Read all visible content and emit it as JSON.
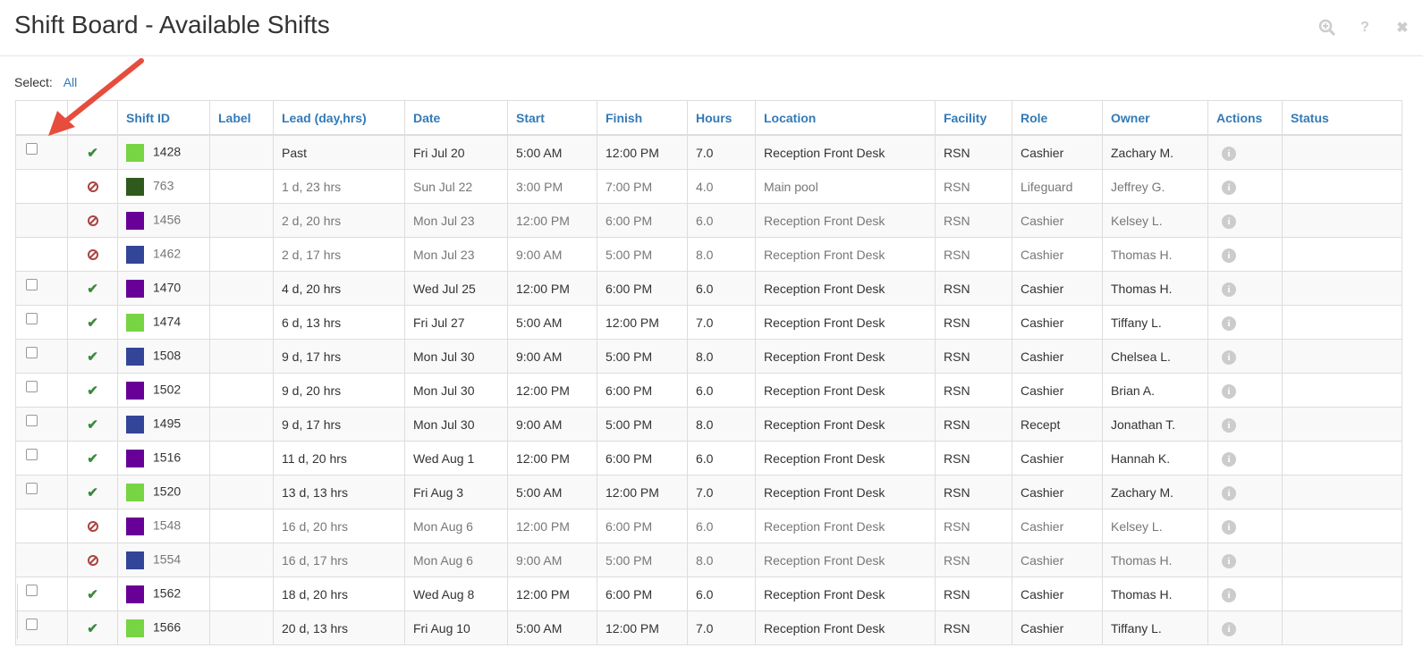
{
  "header": {
    "title": "Shift Board - Available Shifts",
    "icons": [
      "zoom-in-icon",
      "help-icon",
      "close-icon"
    ],
    "help_glyph": "?",
    "close_glyph": "✖"
  },
  "select": {
    "label": "Select:",
    "all_link": "All"
  },
  "columns": [
    "",
    "",
    "Shift ID",
    "Label",
    "Lead (day,hrs)",
    "Date",
    "Start",
    "Finish",
    "Hours",
    "Location",
    "Facility",
    "Role",
    "Owner",
    "Actions",
    "Status"
  ],
  "colors": {
    "green": "#77d442",
    "darkgreen": "#2f5a1e",
    "purple": "#680097",
    "blue": "#334599",
    "ok": "#3c8a3c",
    "blocked": "#a94442",
    "link": "#337ab7"
  },
  "rows": [
    {
      "selectable": true,
      "status": "ok",
      "color": "green",
      "id": "1428",
      "label": "",
      "lead": "Past",
      "date": "Fri Jul 20",
      "start": "5:00 AM",
      "finish": "12:00 PM",
      "hours": "7.0",
      "location": "Reception Front Desk",
      "facility": "RSN",
      "role": "Cashier",
      "owner": "Zachary M.",
      "status_text": ""
    },
    {
      "selectable": false,
      "status": "blocked",
      "color": "darkgreen",
      "id": "763",
      "label": "",
      "lead": "1 d, 23 hrs",
      "date": "Sun Jul 22",
      "start": "3:00 PM",
      "finish": "7:00 PM",
      "hours": "4.0",
      "location": "Main pool",
      "facility": "RSN",
      "role": "Lifeguard",
      "owner": "Jeffrey G.",
      "status_text": ""
    },
    {
      "selectable": false,
      "status": "blocked",
      "color": "purple",
      "id": "1456",
      "label": "",
      "lead": "2 d, 20 hrs",
      "date": "Mon Jul 23",
      "start": "12:00 PM",
      "finish": "6:00 PM",
      "hours": "6.0",
      "location": "Reception Front Desk",
      "facility": "RSN",
      "role": "Cashier",
      "owner": "Kelsey L.",
      "status_text": ""
    },
    {
      "selectable": false,
      "status": "blocked",
      "color": "blue",
      "id": "1462",
      "label": "",
      "lead": "2 d, 17 hrs",
      "date": "Mon Jul 23",
      "start": "9:00 AM",
      "finish": "5:00 PM",
      "hours": "8.0",
      "location": "Reception Front Desk",
      "facility": "RSN",
      "role": "Cashier",
      "owner": "Thomas H.",
      "status_text": ""
    },
    {
      "selectable": true,
      "status": "ok",
      "color": "purple",
      "id": "1470",
      "label": "",
      "lead": "4 d, 20 hrs",
      "date": "Wed Jul 25",
      "start": "12:00 PM",
      "finish": "6:00 PM",
      "hours": "6.0",
      "location": "Reception Front Desk",
      "facility": "RSN",
      "role": "Cashier",
      "owner": "Thomas H.",
      "status_text": ""
    },
    {
      "selectable": true,
      "status": "ok",
      "color": "green",
      "id": "1474",
      "label": "",
      "lead": "6 d, 13 hrs",
      "date": "Fri Jul 27",
      "start": "5:00 AM",
      "finish": "12:00 PM",
      "hours": "7.0",
      "location": "Reception Front Desk",
      "facility": "RSN",
      "role": "Cashier",
      "owner": "Tiffany L.",
      "status_text": ""
    },
    {
      "selectable": true,
      "status": "ok",
      "color": "blue",
      "id": "1508",
      "label": "",
      "lead": "9 d, 17 hrs",
      "date": "Mon Jul 30",
      "start": "9:00 AM",
      "finish": "5:00 PM",
      "hours": "8.0",
      "location": "Reception Front Desk",
      "facility": "RSN",
      "role": "Cashier",
      "owner": "Chelsea L.",
      "status_text": ""
    },
    {
      "selectable": true,
      "status": "ok",
      "color": "purple",
      "id": "1502",
      "label": "",
      "lead": "9 d, 20 hrs",
      "date": "Mon Jul 30",
      "start": "12:00 PM",
      "finish": "6:00 PM",
      "hours": "6.0",
      "location": "Reception Front Desk",
      "facility": "RSN",
      "role": "Cashier",
      "owner": "Brian A.",
      "status_text": ""
    },
    {
      "selectable": true,
      "status": "ok",
      "color": "blue",
      "id": "1495",
      "label": "",
      "lead": "9 d, 17 hrs",
      "date": "Mon Jul 30",
      "start": "9:00 AM",
      "finish": "5:00 PM",
      "hours": "8.0",
      "location": "Reception Front Desk",
      "facility": "RSN",
      "role": "Recept",
      "owner": "Jonathan T.",
      "status_text": ""
    },
    {
      "selectable": true,
      "status": "ok",
      "color": "purple",
      "id": "1516",
      "label": "",
      "lead": "11 d, 20 hrs",
      "date": "Wed Aug 1",
      "start": "12:00 PM",
      "finish": "6:00 PM",
      "hours": "6.0",
      "location": "Reception Front Desk",
      "facility": "RSN",
      "role": "Cashier",
      "owner": "Hannah K.",
      "status_text": ""
    },
    {
      "selectable": true,
      "status": "ok",
      "color": "green",
      "id": "1520",
      "label": "",
      "lead": "13 d, 13 hrs",
      "date": "Fri Aug 3",
      "start": "5:00 AM",
      "finish": "12:00 PM",
      "hours": "7.0",
      "location": "Reception Front Desk",
      "facility": "RSN",
      "role": "Cashier",
      "owner": "Zachary M.",
      "status_text": ""
    },
    {
      "selectable": false,
      "status": "blocked",
      "color": "purple",
      "id": "1548",
      "label": "",
      "lead": "16 d, 20 hrs",
      "date": "Mon Aug 6",
      "start": "12:00 PM",
      "finish": "6:00 PM",
      "hours": "6.0",
      "location": "Reception Front Desk",
      "facility": "RSN",
      "role": "Cashier",
      "owner": "Kelsey L.",
      "status_text": ""
    },
    {
      "selectable": false,
      "status": "blocked",
      "color": "blue",
      "id": "1554",
      "label": "",
      "lead": "16 d, 17 hrs",
      "date": "Mon Aug 6",
      "start": "9:00 AM",
      "finish": "5:00 PM",
      "hours": "8.0",
      "location": "Reception Front Desk",
      "facility": "RSN",
      "role": "Cashier",
      "owner": "Thomas H.",
      "status_text": ""
    },
    {
      "selectable": true,
      "status": "ok",
      "color": "purple",
      "id": "1562",
      "label": "",
      "lead": "18 d, 20 hrs",
      "date": "Wed Aug 8",
      "start": "12:00 PM",
      "finish": "6:00 PM",
      "hours": "6.0",
      "location": "Reception Front Desk",
      "facility": "RSN",
      "role": "Cashier",
      "owner": "Thomas H.",
      "status_text": ""
    },
    {
      "selectable": true,
      "status": "ok",
      "color": "green",
      "id": "1566",
      "label": "",
      "lead": "20 d, 13 hrs",
      "date": "Fri Aug 10",
      "start": "5:00 AM",
      "finish": "12:00 PM",
      "hours": "7.0",
      "location": "Reception Front Desk",
      "facility": "RSN",
      "role": "Cashier",
      "owner": "Tiffany L.",
      "status_text": ""
    }
  ],
  "annotation": {
    "type": "arrow",
    "color": "#e74c3c",
    "points_to": "first-row-checkbox"
  }
}
